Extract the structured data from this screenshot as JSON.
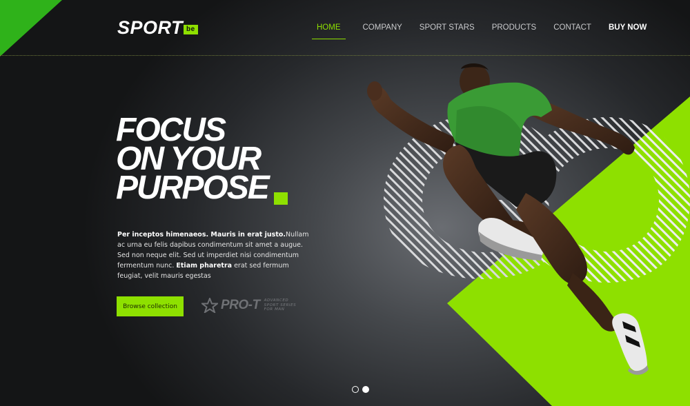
{
  "brand": {
    "name": "SPORT",
    "badge": "be"
  },
  "nav": {
    "items": [
      {
        "label": "HOME",
        "active": true
      },
      {
        "label": "COMPANY",
        "active": false
      },
      {
        "label": "SPORT STARS",
        "active": false
      },
      {
        "label": "PRODUCTS",
        "active": false
      },
      {
        "label": "CONTACT",
        "active": false
      },
      {
        "label": "BUY NOW",
        "active": false
      }
    ]
  },
  "hero": {
    "headline": [
      "FOCUS",
      "ON YOUR",
      "PURPOSE"
    ],
    "body": {
      "bold_1": "Per inceptos himenaeos. Mauris in erat justo.",
      "text_1": "Nullam ac urna eu felis dapibus condimentum sit amet a augue. Sed non neque elit. Sed ut imperdiet nisi condimentum fermentum nunc. ",
      "bold_2": "Etiam pharetra",
      "text_2": " erat sed fermum feugiat, velit mauris egestas"
    },
    "cta_label": "Browse collection",
    "partner": {
      "name": "PRO-T",
      "tagline": "ADVANCED SPORT SERIES FOR MAN"
    },
    "background_word": "GO"
  },
  "slider": {
    "count": 2,
    "active_index": 1
  },
  "colors": {
    "accent": "#8ee000",
    "corner": "#2fb21a",
    "background": "#1a1b1d",
    "shirt": "#3a9b35"
  }
}
